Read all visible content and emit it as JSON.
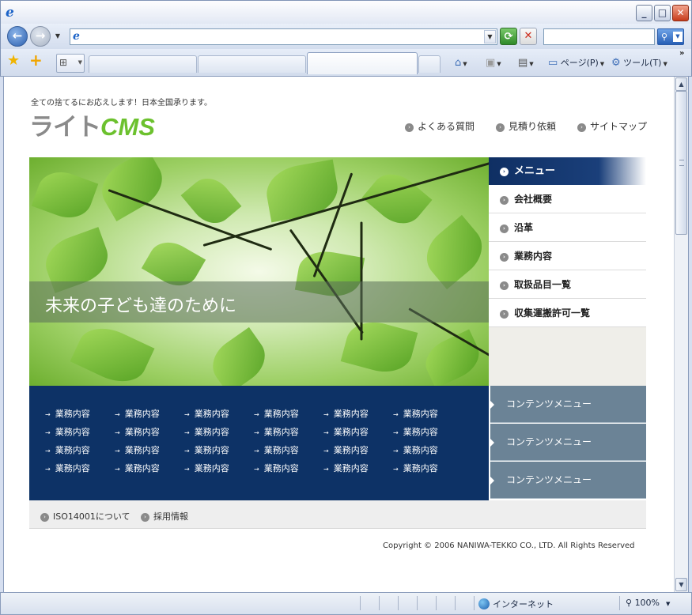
{
  "browser": {
    "address_value": "",
    "search_placeholder": "",
    "commands": {
      "page": "ページ(P)",
      "tools": "ツール(T)"
    }
  },
  "site": {
    "tagline": "全ての捨てるにお応えします！日本全国承ります。",
    "logo_kana": "ライト",
    "logo_cms": "CMS",
    "top_nav": [
      "よくある質問",
      "見積り依頼",
      "サイトマップ"
    ],
    "hero_text": "未来の子ども達のために",
    "side_menu": {
      "header": "メニュー",
      "items": [
        "会社概要",
        "沿革",
        "業務内容",
        "取扱品目一覧",
        "収集運搬許可一覧"
      ]
    },
    "grid_rows": [
      [
        "業務内容",
        "業務内容",
        "業務内容",
        "業務内容",
        "業務内容",
        "業務内容"
      ],
      [
        "業務内容",
        "業務内容",
        "業務内容",
        "業務内容",
        "業務内容",
        "業務内容"
      ],
      [
        "業務内容",
        "業務内容",
        "業務内容",
        "業務内容",
        "業務内容",
        "業務内容"
      ],
      [
        "業務内容",
        "業務内容",
        "業務内容",
        "業務内容",
        "業務内容",
        "業務内容"
      ]
    ],
    "content_menu": [
      "コンテンツメニュー",
      "コンテンツメニュー",
      "コンテンツメニュー"
    ],
    "footer_links": [
      "ISO14001について",
      "採用情報"
    ],
    "copyright": "Copyright © 2006 NANIWA-TEKKO CO., LTD. All Rights Reserved"
  },
  "status": {
    "zone": "インターネット",
    "zoom": "100%"
  },
  "colors": {
    "navy": "#0d3266",
    "accent_green": "#6cc12e",
    "content_menu": "#6b8396"
  }
}
